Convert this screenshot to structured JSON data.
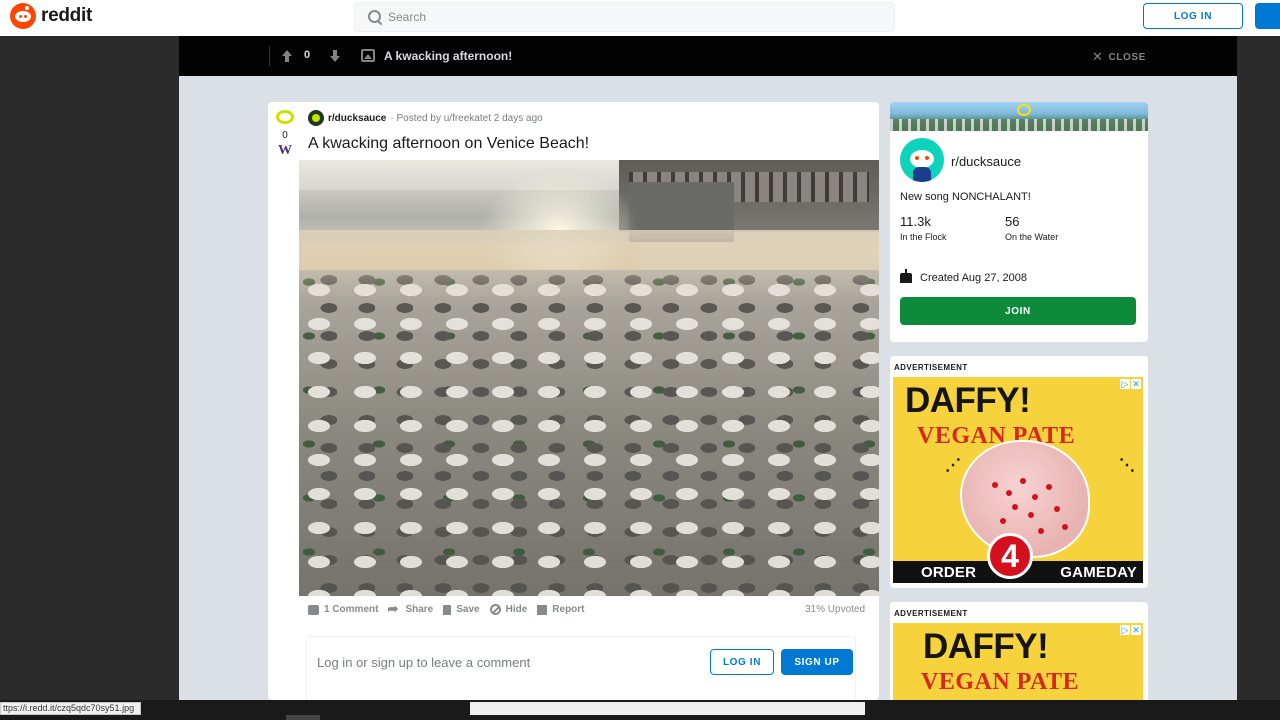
{
  "header": {
    "logo_text": "reddit",
    "search_placeholder": "Search",
    "login_label": "LOG IN"
  },
  "topbar": {
    "score": "0",
    "title": "A kwacking afternoon!",
    "close_label": "CLOSE"
  },
  "post": {
    "vote_count": "0",
    "flair_letter": "W",
    "subreddit": "r/ducksauce",
    "posted_by": "Posted by u/freekatet 2 days ago",
    "title": "A kwacking afternoon on Venice Beach!",
    "actions": {
      "comments": "1 Comment",
      "share": "Share",
      "save": "Save",
      "hide": "Hide",
      "report": "Report"
    },
    "upvoted": "31% Upvoted",
    "comment_prompt": "Log in or sign up to leave a comment",
    "login_label": "LOG IN",
    "signup_label": "SIGN UP"
  },
  "sidebar": {
    "name": "r/ducksauce",
    "description": "New song NONCHALANT!",
    "members_count": "11.3k",
    "members_label": "In the Flock",
    "online_count": "56",
    "online_label": "On the Water",
    "created": "Created Aug 27, 2008",
    "join_label": "JOIN"
  },
  "ads": [
    {
      "label": "ADVERTISEMENT",
      "headline": "DAFFY!",
      "subheadline": "VEGAN PATE",
      "badge_number": "4",
      "bottom_left": "ORDER",
      "bottom_right": "GAMEDAY"
    },
    {
      "label": "ADVERTISEMENT",
      "headline": "DAFFY!",
      "subheadline": "VEGAN PATE"
    }
  ],
  "status": {
    "url": "ttps://i.redd.it/czq5qdc70sy51.jpg"
  },
  "colors": {
    "accent": "#0079d3",
    "join": "#0e8a3c",
    "brand": "#ff4500",
    "ad_yellow": "#f6d23c",
    "ad_red": "#d5101e"
  }
}
